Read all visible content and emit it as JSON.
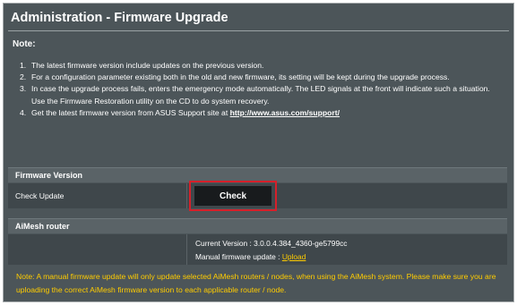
{
  "page": {
    "title": "Administration - Firmware Upgrade",
    "note_heading": "Note:"
  },
  "notes": [
    {
      "num": "1.",
      "text": "The latest firmware version include updates on the previous version."
    },
    {
      "num": "2.",
      "text": "For a configuration parameter existing both in the old and new firmware, its setting will be kept during the upgrade process."
    },
    {
      "num": "3.",
      "text": "In case the upgrade process fails, enters the emergency mode automatically. The LED signals at the front will indicate such a situation. Use the Firmware Restoration utility on the CD to do system recovery."
    },
    {
      "num": "4.",
      "text": "Get the latest firmware version from ASUS Support site at ",
      "link": "http://www.asus.com/support/"
    }
  ],
  "firmware_version": {
    "header": "Firmware Version",
    "check_update_label": "Check Update",
    "check_button": "Check"
  },
  "aimesh": {
    "header": "AiMesh router",
    "current_version": "Current Version : 3.0.0.4.384_4360-ge5799cc",
    "manual_update_label": "Manual firmware update : ",
    "upload_link": "Upload"
  },
  "footer_note": "Note: A manual firmware update will only update selected AiMesh routers / nodes, when using the AiMesh system. Please make sure you are uploading the correct AiMesh firmware version to each applicable router / node.",
  "colors": {
    "panel": "#4c5559",
    "highlight_outline": "#d6202a",
    "warning_text": "#ffcc00"
  }
}
